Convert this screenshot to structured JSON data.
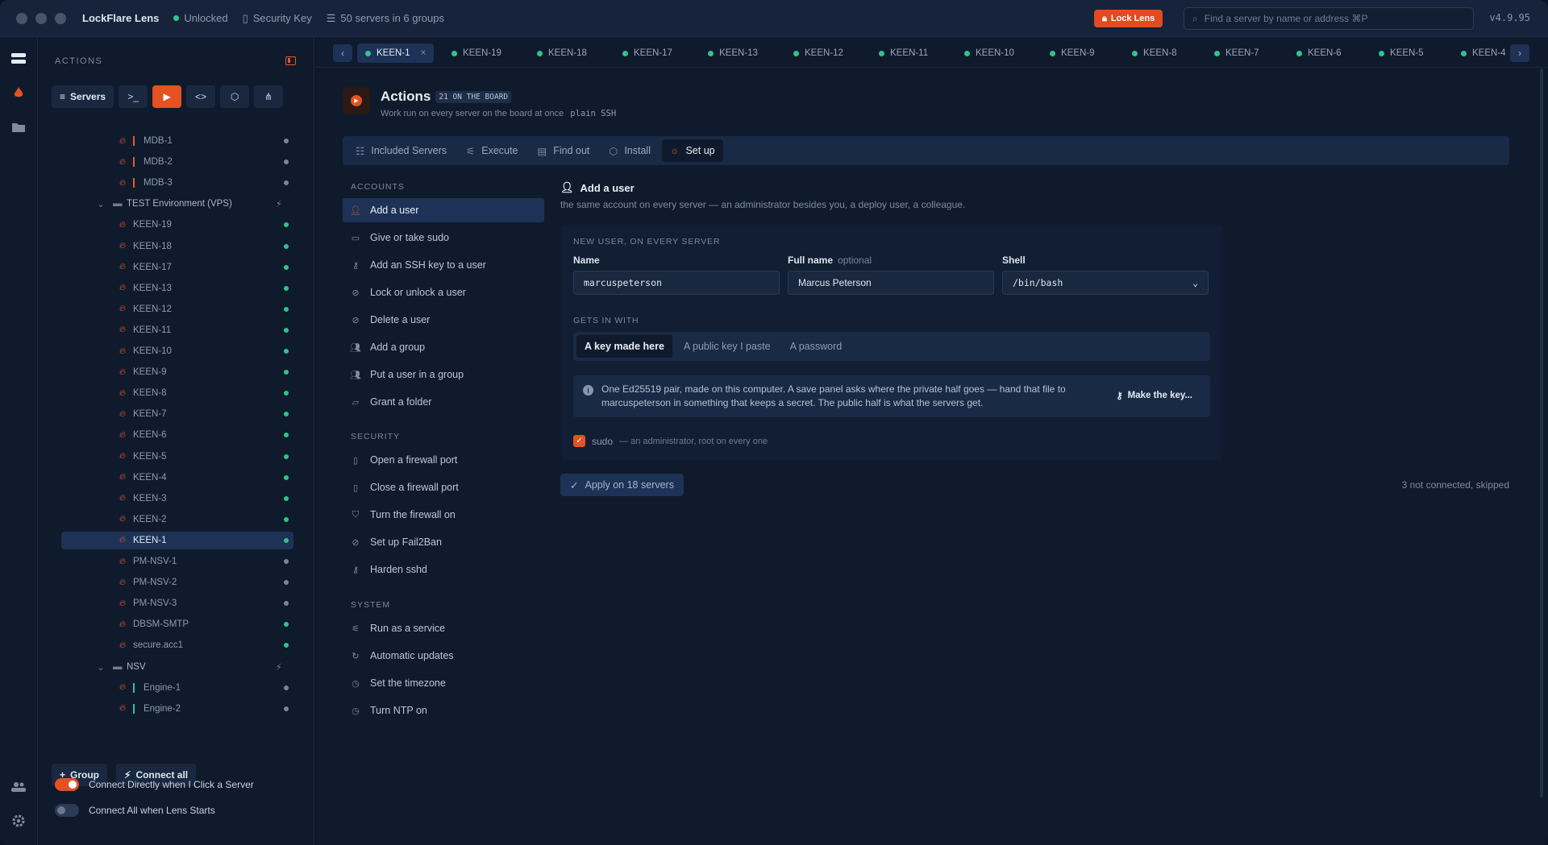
{
  "app": {
    "title": "LockFlare Lens",
    "status": "Unlocked",
    "key": "Security Key",
    "servers_summary": "50 servers in 6 groups",
    "lock_label": "Lock Lens",
    "search_placeholder": "Find a server by name or address  ⌘P",
    "version": "v4.9.95"
  },
  "sidebar": {
    "heading": "ACTIONS",
    "servers_tab": "Servers",
    "tree": [
      {
        "name": "MDB-1",
        "type": "server",
        "indent": 2,
        "status": "grey",
        "bar": "orange"
      },
      {
        "name": "MDB-2",
        "type": "server",
        "indent": 2,
        "status": "grey",
        "bar": "orange"
      },
      {
        "name": "MDB-3",
        "type": "server",
        "indent": 2,
        "status": "grey",
        "bar": "orange"
      },
      {
        "name": "TEST Environment (VPS)",
        "type": "group"
      },
      {
        "name": "KEEN-19",
        "type": "server",
        "indent": 1,
        "status": "green"
      },
      {
        "name": "KEEN-18",
        "type": "server",
        "indent": 1,
        "status": "green"
      },
      {
        "name": "KEEN-17",
        "type": "server",
        "indent": 1,
        "status": "green"
      },
      {
        "name": "KEEN-13",
        "type": "server",
        "indent": 1,
        "status": "green"
      },
      {
        "name": "KEEN-12",
        "type": "server",
        "indent": 1,
        "status": "green"
      },
      {
        "name": "KEEN-11",
        "type": "server",
        "indent": 1,
        "status": "green"
      },
      {
        "name": "KEEN-10",
        "type": "server",
        "indent": 1,
        "status": "green"
      },
      {
        "name": "KEEN-9",
        "type": "server",
        "indent": 1,
        "status": "green"
      },
      {
        "name": "KEEN-8",
        "type": "server",
        "indent": 1,
        "status": "green"
      },
      {
        "name": "KEEN-7",
        "type": "server",
        "indent": 1,
        "status": "green"
      },
      {
        "name": "KEEN-6",
        "type": "server",
        "indent": 1,
        "status": "green"
      },
      {
        "name": "KEEN-5",
        "type": "server",
        "indent": 1,
        "status": "green"
      },
      {
        "name": "KEEN-4",
        "type": "server",
        "indent": 1,
        "status": "green"
      },
      {
        "name": "KEEN-3",
        "type": "server",
        "indent": 1,
        "status": "green"
      },
      {
        "name": "KEEN-2",
        "type": "server",
        "indent": 1,
        "status": "green"
      },
      {
        "name": "KEEN-1",
        "type": "server",
        "indent": 1,
        "status": "green",
        "selected": true
      },
      {
        "name": "PM-NSV-1",
        "type": "server",
        "indent": 1,
        "status": "grey"
      },
      {
        "name": "PM-NSV-2",
        "type": "server",
        "indent": 1,
        "status": "grey"
      },
      {
        "name": "PM-NSV-3",
        "type": "server",
        "indent": 1,
        "status": "grey"
      },
      {
        "name": "DBSM-SMTP",
        "type": "server",
        "indent": 1,
        "status": "green"
      },
      {
        "name": "secure.acc1",
        "type": "server",
        "indent": 1,
        "status": "green"
      },
      {
        "name": "NSV",
        "type": "group"
      },
      {
        "name": "Engine-1",
        "type": "server",
        "indent": 2,
        "status": "grey",
        "bar": "green"
      },
      {
        "name": "Engine-2",
        "type": "server",
        "indent": 2,
        "status": "grey",
        "bar": "green"
      }
    ],
    "group_btn": "Group",
    "connect_all_btn": "Connect all",
    "toggle1": "Connect Directly when I Click a Server",
    "toggle2": "Connect All when Lens Starts"
  },
  "tabs": [
    "KEEN-1",
    "KEEN-19",
    "KEEN-18",
    "KEEN-17",
    "KEEN-13",
    "KEEN-12",
    "KEEN-11",
    "KEEN-10",
    "KEEN-9",
    "KEEN-8",
    "KEEN-7",
    "KEEN-6",
    "KEEN-5",
    "KEEN-4"
  ],
  "main": {
    "title": "Actions",
    "badge": "21 ON THE BOARD",
    "subtitle": "Work run on every server on the board at once",
    "subtitle_mono": "plain SSH",
    "section_tabs": [
      "Included Servers",
      "Execute",
      "Find out",
      "Install",
      "Set up"
    ],
    "categories": {
      "accounts": "ACCOUNTS",
      "security": "SECURITY",
      "system": "SYSTEM"
    },
    "accounts": [
      "Add a user",
      "Give or take sudo",
      "Add an SSH key to a user",
      "Lock or unlock a user",
      "Delete a user",
      "Add a group",
      "Put a user in a group",
      "Grant a folder"
    ],
    "security": [
      "Open a firewall port",
      "Close a firewall port",
      "Turn the firewall on",
      "Set up Fail2Ban",
      "Harden sshd"
    ],
    "system": [
      "Run as a service",
      "Automatic updates",
      "Set the timezone",
      "Turn NTP on"
    ],
    "panel": {
      "heading": "Add a user",
      "desc": "the same account on every server — an administrator besides you, a deploy user, a colleague.",
      "card_heading": "NEW USER, ON EVERY SERVER",
      "name_label": "Name",
      "name_value": "marcuspeterson",
      "fullname_label": "Full name",
      "fullname_optional": "optional",
      "fullname_value": "Marcus Peterson",
      "shell_label": "Shell",
      "shell_value": "/bin/bash",
      "gets_in": "GETS IN WITH",
      "options": [
        "A key made here",
        "A public key I paste",
        "A password"
      ],
      "info": "One Ed25519 pair, made on this computer. A save panel asks where the private half goes — hand that file to marcuspeterson in something that keeps a secret. The public half is what the servers get.",
      "make_key": "Make the key...",
      "sudo_label": "sudo",
      "sudo_desc": "— an administrator, root on every one",
      "apply": "Apply on 18 servers",
      "skipped": "3 not connected, skipped"
    }
  },
  "colors": {
    "accent": "#e45122",
    "green": "#2fc58a",
    "bg": "#0f1a2c"
  }
}
